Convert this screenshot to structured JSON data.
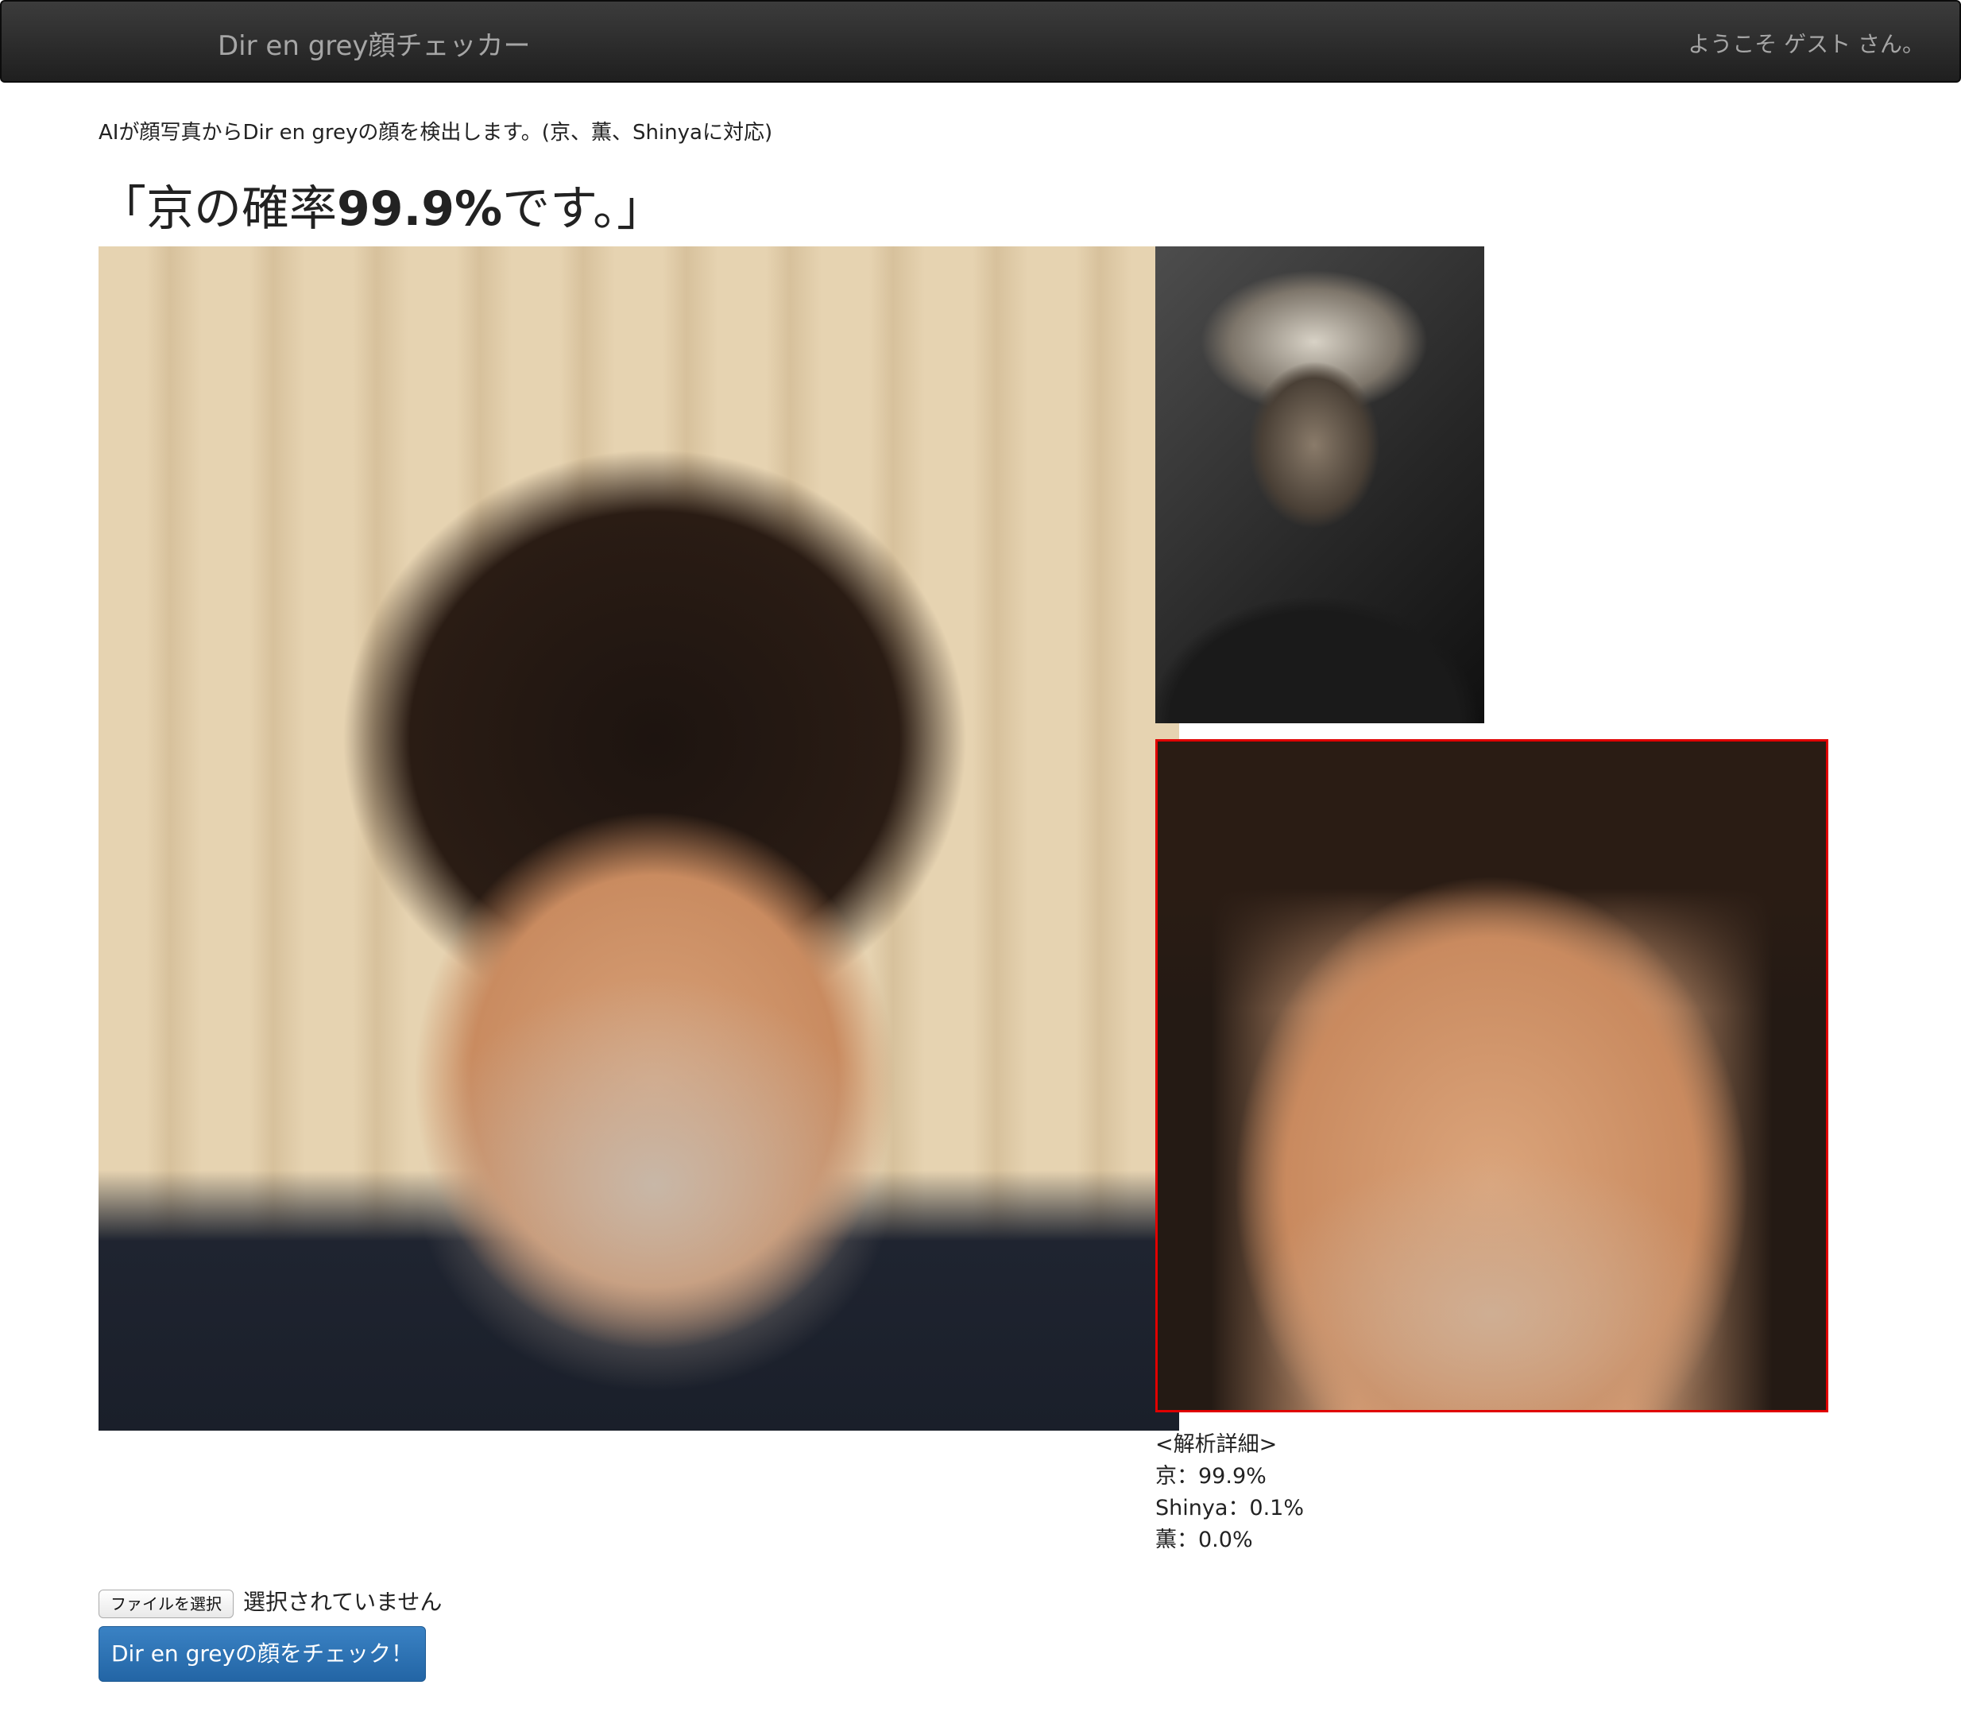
{
  "navbar": {
    "brand": "Dir en grey顔チェッカー",
    "welcome": "ようこそ ゲスト さん。"
  },
  "intro": "AIが顔写真からDir en greyの顔を検出します。(京、薫、Shinyaに対応)",
  "result": {
    "prefix": "「京の確率",
    "percent": "99.9%",
    "suffix": "です。」"
  },
  "images": {
    "main_photo": "uploaded-face-photo",
    "reference_photo": "member-reference-photo",
    "detected_face": "detected-face-crop",
    "detection_box_color": "#e00000"
  },
  "details": {
    "title": "<解析詳細>",
    "rows": [
      {
        "label": "京：99.9%"
      },
      {
        "label": "Shinya：0.1%"
      },
      {
        "label": "薫：0.0%"
      }
    ]
  },
  "upload": {
    "file_button": "ファイルを選択",
    "file_status": "選択されていません",
    "submit": "Dir en greyの顔をチェック！"
  },
  "colors": {
    "navbar_bg": "#2b2b2b",
    "button_primary": "#2c6fb3"
  }
}
